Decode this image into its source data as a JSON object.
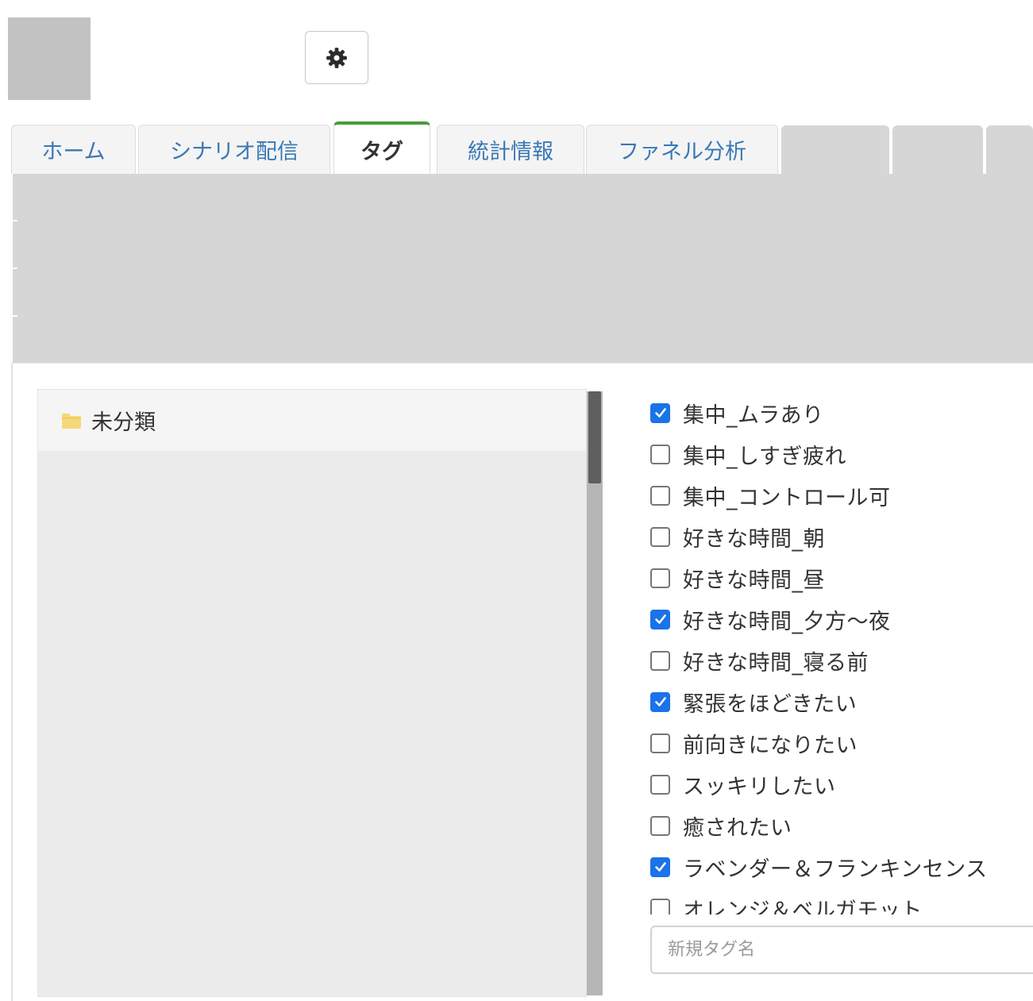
{
  "header": {
    "settings_icon": "gear-icon"
  },
  "tabs": [
    {
      "label": "ホーム",
      "active": false
    },
    {
      "label": "シナリオ配信",
      "active": false
    },
    {
      "label": "タグ",
      "active": true
    },
    {
      "label": "統計情報",
      "active": false
    },
    {
      "label": "ファネル分析",
      "active": false
    }
  ],
  "colors": {
    "active_tab_accent": "#4a9a3c",
    "link": "#3a78b5",
    "checkbox_checked": "#1a73e8",
    "folder": "#f6d77a"
  },
  "folders": [
    {
      "label": "未分類",
      "icon": "folder-icon"
    }
  ],
  "tags": [
    {
      "label": "集中_ムラあり",
      "checked": true
    },
    {
      "label": "集中_しすぎ疲れ",
      "checked": false
    },
    {
      "label": "集中_コントロール可",
      "checked": false
    },
    {
      "label": "好きな時間_朝",
      "checked": false
    },
    {
      "label": "好きな時間_昼",
      "checked": false
    },
    {
      "label": "好きな時間_夕方〜夜",
      "checked": true
    },
    {
      "label": "好きな時間_寝る前",
      "checked": false
    },
    {
      "label": "緊張をほどきたい",
      "checked": true
    },
    {
      "label": "前向きになりたい",
      "checked": false
    },
    {
      "label": "スッキリしたい",
      "checked": false
    },
    {
      "label": "癒されたい",
      "checked": false
    },
    {
      "label": "ラベンダー＆フランキンセンス",
      "checked": true
    },
    {
      "label": "オレンジ＆ベルガモット",
      "checked": false
    }
  ],
  "new_tag": {
    "placeholder": "新規タグ名",
    "value": ""
  }
}
